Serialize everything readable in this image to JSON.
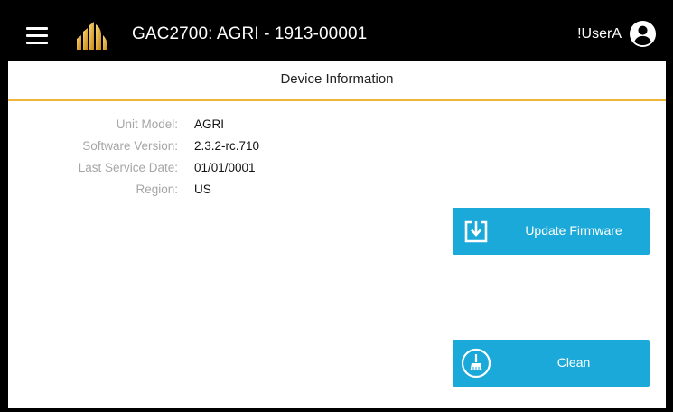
{
  "header": {
    "menu_icon": "hamburger-menu-icon",
    "logo_icon": "gac-logo-icon",
    "device_title": "GAC2700: AGRI - 1913-00001",
    "user_name": "!UserA",
    "user_icon": "account-circle-icon"
  },
  "page": {
    "title": "Device Information"
  },
  "device_info": [
    {
      "label": "Unit Model:",
      "value": "AGRI"
    },
    {
      "label": "Software Version:",
      "value": "2.3.2-rc.710"
    },
    {
      "label": "Last Service Date:",
      "value": "01/01/0001"
    },
    {
      "label": "Region:",
      "value": "US"
    }
  ],
  "actions": {
    "update_firmware": {
      "label": "Update Firmware",
      "icon": "download-tray-icon"
    },
    "clean": {
      "label": "Clean",
      "icon": "broom-icon"
    }
  },
  "colors": {
    "topbar_bg": "#000000",
    "accent_gold": "#f0b63a",
    "button_blue": "#1aa9d8",
    "label_gray": "#a6a6a6"
  }
}
